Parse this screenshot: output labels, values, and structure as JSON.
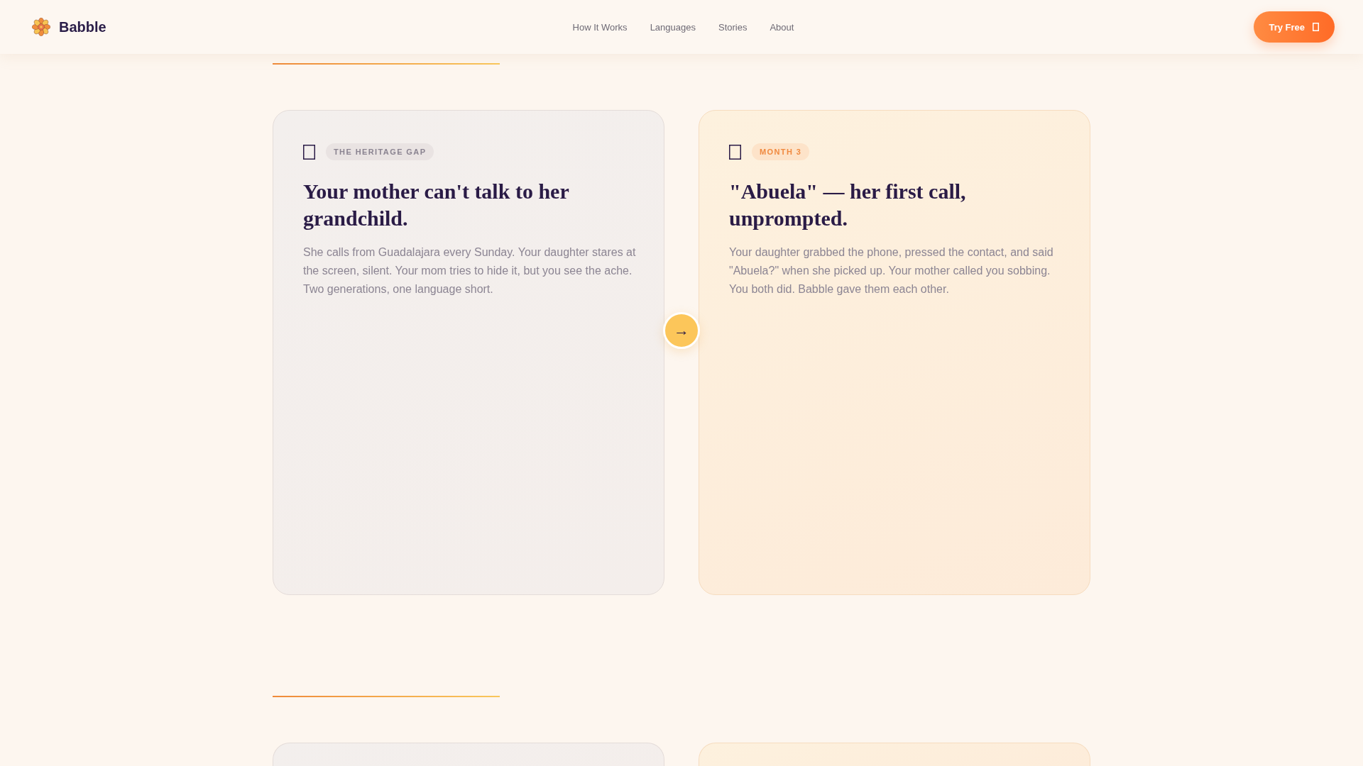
{
  "header": {
    "brand": "Babble",
    "nav": [
      {
        "label": "How It Works"
      },
      {
        "label": "Languages"
      },
      {
        "label": "Stories"
      },
      {
        "label": "About"
      }
    ],
    "cta": {
      "label": "Try Free"
    }
  },
  "sections": [
    {
      "cards": [
        {
          "kind": "before",
          "tag": "THE HERITAGE GAP",
          "title": "Your mother can't talk to her grandchild.",
          "body": "She calls from Guadalajara every Sunday. Your daughter stares at the screen, silent. Your mom tries to hide it, but you see the ache. Two generations, one language short."
        },
        {
          "kind": "after",
          "tag": "MONTH 3",
          "title": "\"Abuela\" — her first call, unprompted.",
          "body": "Your daughter grabbed the phone, pressed the contact, and said \"Abuela?\" when she picked up. Your mother called you sobbing. You both did. Babble gave them each other."
        }
      ],
      "connector": "→"
    },
    {
      "cards": [
        {
          "kind": "before"
        },
        {
          "kind": "after"
        }
      ]
    }
  ]
}
